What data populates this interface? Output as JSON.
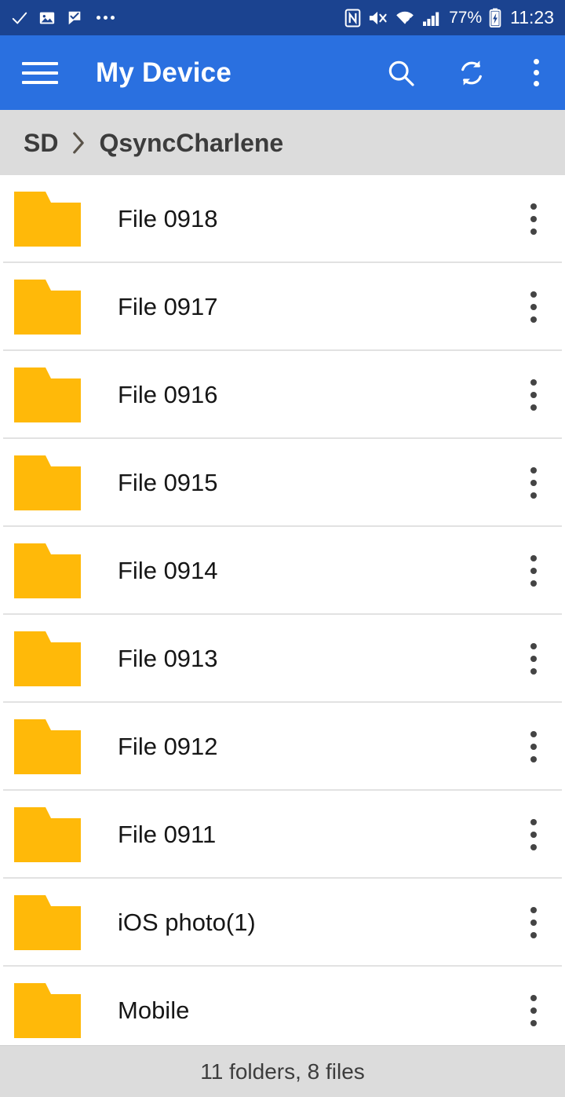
{
  "statusbar": {
    "left_icons": [
      "check-icon",
      "photo-icon",
      "flag-check-icon",
      "more-dots-icon"
    ],
    "right_icons": [
      "nfc-icon",
      "mute-icon",
      "wifi-icon",
      "signal-icon"
    ],
    "battery_percent": "77%",
    "battery_icon": "battery-charging-icon",
    "clock": "11:23",
    "background": "#1b4390"
  },
  "appbar": {
    "menu_icon": "hamburger-menu-icon",
    "title": "My Device",
    "search_icon": "search-icon",
    "refresh_icon": "refresh-icon",
    "overflow_icon": "overflow-menu-icon",
    "background": "#2a70e0"
  },
  "breadcrumb": {
    "items": [
      {
        "label": "SD"
      },
      {
        "label": "QsyncCharlene"
      }
    ],
    "separator_icon": "chevron-right-icon",
    "background": "#dcdcdc"
  },
  "filelist": {
    "folder_icon": "folder-icon",
    "row_menu_icon": "overflow-menu-icon",
    "folder_color": "#ffb909",
    "rows": [
      {
        "name": "File 0918",
        "type": "folder"
      },
      {
        "name": "File 0917",
        "type": "folder"
      },
      {
        "name": "File 0916",
        "type": "folder"
      },
      {
        "name": "File 0915",
        "type": "folder"
      },
      {
        "name": "File 0914",
        "type": "folder"
      },
      {
        "name": "File 0913",
        "type": "folder"
      },
      {
        "name": "File 0912",
        "type": "folder"
      },
      {
        "name": "File 0911",
        "type": "folder"
      },
      {
        "name": "iOS photo(1)",
        "type": "folder"
      },
      {
        "name": "Mobile",
        "type": "folder"
      }
    ]
  },
  "bottombar": {
    "summary": "11 folders, 8 files",
    "background": "#dcdcdc"
  }
}
